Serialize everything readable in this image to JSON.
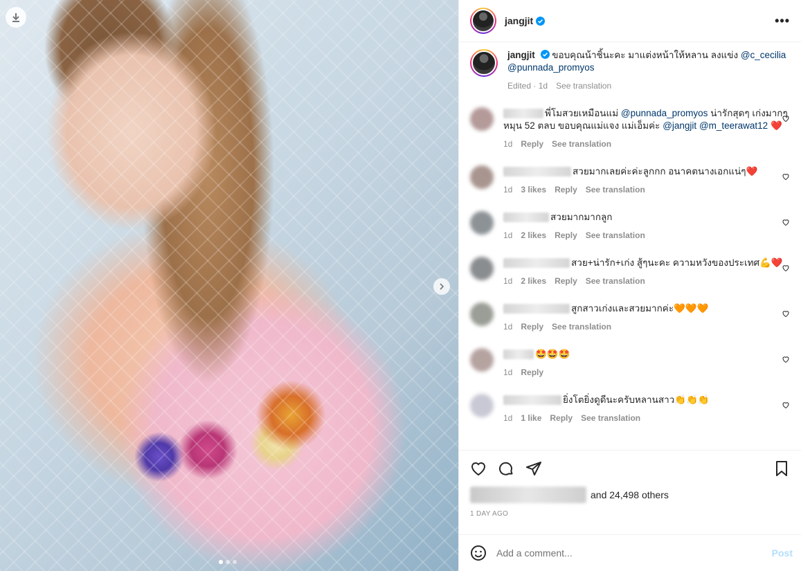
{
  "post": {
    "username": "jangjit",
    "more_icon": "ellipsis-icon"
  },
  "caption": {
    "username": "jangjit",
    "text": "ขอบคุณน้าชิ้นะคะ มาแต่งหน้าให้หลาน ลงแข่ง ",
    "mention1": "@c_cecilia",
    "mention2": "@punnada_promyos",
    "edited": "Edited",
    "time": "1d",
    "see_translation": "See translation"
  },
  "comments": [
    {
      "pre": "พี่โมสวยเหมือนแม่ ",
      "m1": "@punnada_promyos",
      "mid": " น่ารักสุดๆ เก่งมากๆ หมุน 52 ตลบ ขอบคุณแม่แจง แม่เอ็มค่ะ ",
      "m2": "@jangjit",
      "m3": "@m_teerawat12",
      "emoji": "❤️",
      "time": "1d",
      "likes": "",
      "reply": "Reply",
      "see": "See translation",
      "avatar": "#b49a99",
      "namew": "58"
    },
    {
      "pre": "สวยมากเลยค่ะค่ะลูกกก อนาคตนางเอกแน่ๆ",
      "emoji": "❤️",
      "time": "1d",
      "likes": "3 likes",
      "reply": "Reply",
      "see": "See translation",
      "avatar": "#a9958f",
      "namew": "98"
    },
    {
      "pre": "สวยมากมากลูก",
      "emoji": "",
      "time": "1d",
      "likes": "2 likes",
      "reply": "Reply",
      "see": "See translation",
      "avatar": "#8c9296",
      "namew": "66"
    },
    {
      "pre": "สวย+น่ารัก+เก่ง สู้ๆนะคะ ความหวังของประเทศ",
      "emoji": "💪❤️",
      "time": "1d",
      "likes": "2 likes",
      "reply": "Reply",
      "see": "See translation",
      "avatar": "#8a8d90",
      "namew": "96"
    },
    {
      "pre": "สูกสาวเก่งและสวยมากค่ะ",
      "emoji": "🧡🧡🧡",
      "time": "1d",
      "likes": "",
      "reply": "Reply",
      "see": "See translation",
      "avatar": "#9a9e96",
      "namew": "96"
    },
    {
      "pre": "",
      "emoji": "🤩🤩🤩",
      "time": "1d",
      "likes": "",
      "reply": "Reply",
      "see": "",
      "avatar": "#b5a3a0",
      "namew": "44"
    },
    {
      "pre": "ยิ่งโตยิ่งดูดีนะครับหลานสาว",
      "emoji": "👏👏👏",
      "time": "1d",
      "likes": "1 like",
      "reply": "Reply",
      "see": "See translation",
      "avatar": "#c9c9d6",
      "namew": "84"
    }
  ],
  "likes": {
    "text": "and 24,498 others"
  },
  "date": "1 DAY AGO",
  "add_comment": {
    "placeholder": "Add a comment...",
    "post": "Post"
  },
  "colors": {
    "link": "#00376b",
    "meta": "#8e8e8e",
    "post": "#b2dffc",
    "verified": "#0095f6"
  }
}
